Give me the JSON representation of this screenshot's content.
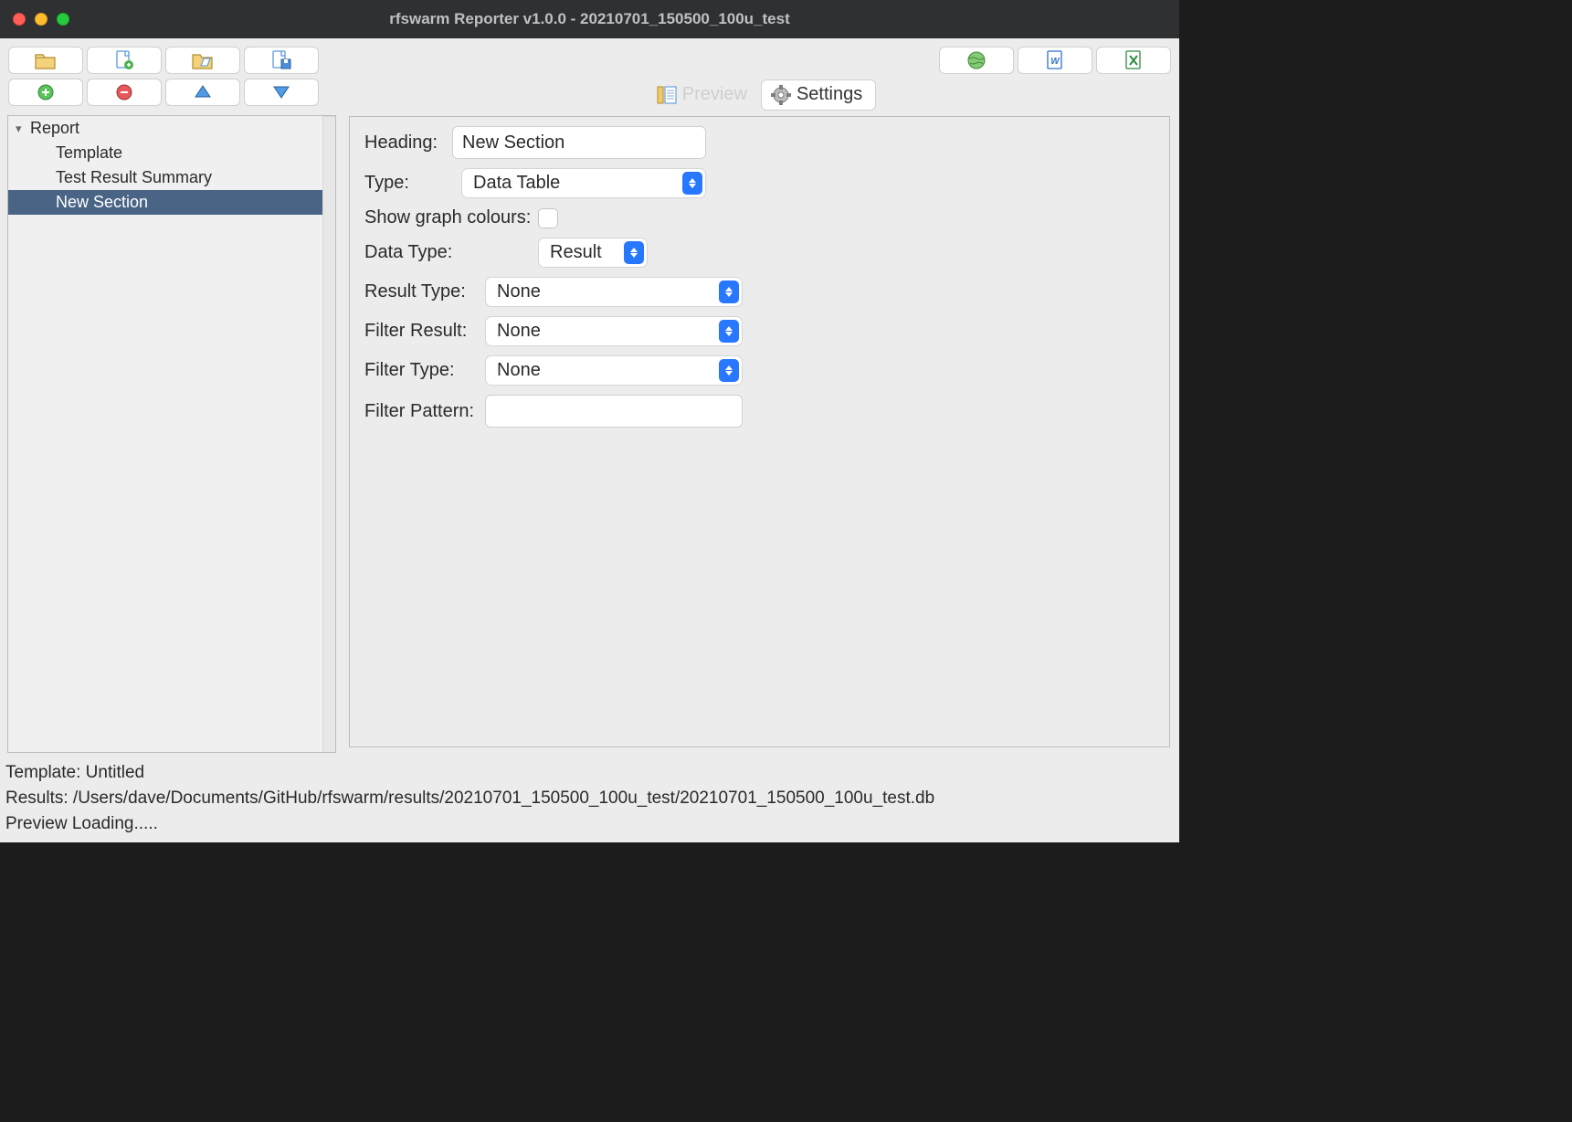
{
  "window": {
    "title": "rfswarm Reporter v1.0.0 - 20210701_150500_100u_test"
  },
  "tree": {
    "root": "Report",
    "children": [
      "Template",
      "Test Result Summary",
      "New Section"
    ],
    "selected_index": 2
  },
  "tabs": {
    "preview": "Preview",
    "settings": "Settings"
  },
  "settings": {
    "heading_label": "Heading:",
    "heading_value": "New Section",
    "type_label": "Type:",
    "type_value": "Data Table",
    "show_graph_colours_label": "Show graph colours:",
    "show_graph_colours_checked": false,
    "data_type_label": "Data Type:",
    "data_type_value": "Result",
    "result_type_label": "Result Type:",
    "result_type_value": "None",
    "filter_result_label": "Filter Result:",
    "filter_result_value": "None",
    "filter_type_label": "Filter Type:",
    "filter_type_value": "None",
    "filter_pattern_label": "Filter Pattern:",
    "filter_pattern_value": ""
  },
  "status": {
    "template_line": "Template: Untitled",
    "results_line": "Results: /Users/dave/Documents/GitHub/rfswarm/results/20210701_150500_100u_test/20210701_150500_100u_test.db",
    "preview_line": "Preview Loading....."
  }
}
